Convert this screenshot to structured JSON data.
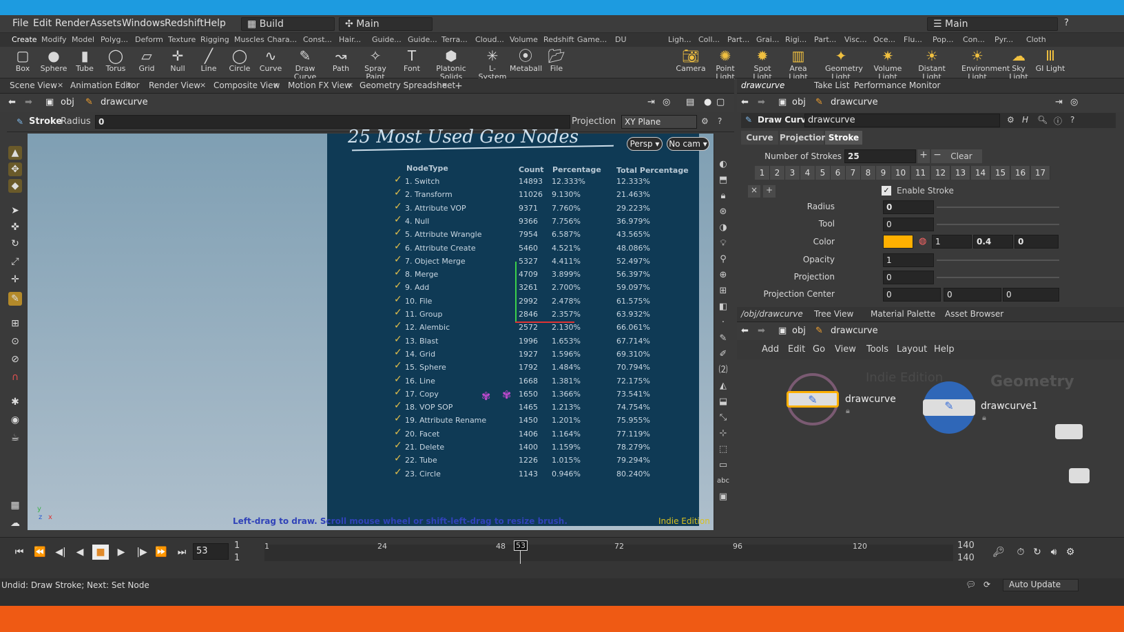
{
  "menu": [
    "File",
    "Edit",
    "Render",
    "Assets",
    "Windows",
    "Redshift",
    "Help"
  ],
  "desktop": {
    "build": "Build",
    "main": "Main",
    "right_main": "Main"
  },
  "shelf_tabs_left": [
    "Create",
    "Modify",
    "Model",
    "Polyg...",
    "Deform",
    "Texture",
    "Rigging",
    "Muscles",
    "Chara...",
    "Const...",
    "Hair...",
    "Guide...",
    "Guide...",
    "Terra...",
    "Cloud...",
    "Volume",
    "Redshift",
    "Game...",
    "DU"
  ],
  "shelf_tabs_right": [
    "Ligh...",
    "Coll...",
    "Part...",
    "Grai...",
    "Rigi...",
    "Part...",
    "Visc...",
    "Oce...",
    "Flu...",
    "Pop...",
    "Con...",
    "Pyr...",
    "Cloth"
  ],
  "tools_left": [
    "Box",
    "Sphere",
    "Tube",
    "Torus",
    "Grid",
    "Null",
    "Line",
    "Circle",
    "Curve",
    "Draw Curve",
    "Path",
    "Spray Paint",
    "Font",
    "Platonic Solids",
    "L-System",
    "Metaball",
    "File"
  ],
  "tools_right": [
    "Camera",
    "Point Light",
    "Spot Light",
    "Area Light",
    "Geometry Light",
    "Volume Light",
    "Distant Light",
    "Environment Light",
    "Sky Light",
    "GI Light"
  ],
  "pane_tabs_left": [
    "Scene View",
    "Animation Editor",
    "Render View",
    "Composite View",
    "Motion FX View",
    "Geometry Spreadsheet"
  ],
  "pane_tabs_right": [
    "drawcurve",
    "Take List",
    "Performance Monitor"
  ],
  "path": {
    "obj": "obj",
    "node": "drawcurve"
  },
  "stroke_bar": {
    "label": "Stroke",
    "radius_label": "Radius",
    "radius_value": "0",
    "projection_label": "Projection",
    "projection_value": "XY Plane"
  },
  "viewport": {
    "persp": "Persp",
    "nocam": "No cam",
    "hint": "Left-drag to draw.  Scroll mouse wheel or shift-left-drag to resize brush.",
    "edition": "Indie Edition",
    "title": "25 Most Used Geo Nodes"
  },
  "table": {
    "headers": [
      "NodeType",
      "Count",
      "Percentage",
      "Total Percentage"
    ],
    "rows": [
      [
        "1. Switch",
        "14893",
        "12.333%",
        "12.333%"
      ],
      [
        "2. Transform",
        "11026",
        "9.130%",
        "21.463%"
      ],
      [
        "3. Attribute VOP",
        "9371",
        "7.760%",
        "29.223%"
      ],
      [
        "4. Null",
        "9366",
        "7.756%",
        "36.979%"
      ],
      [
        "5. Attribute Wrangle",
        "7954",
        "6.587%",
        "43.565%"
      ],
      [
        "6. Attribute Create",
        "5460",
        "4.521%",
        "48.086%"
      ],
      [
        "7. Object Merge",
        "5327",
        "4.411%",
        "52.497%"
      ],
      [
        "8. Merge",
        "4709",
        "3.899%",
        "56.397%"
      ],
      [
        "9. Add",
        "3261",
        "2.700%",
        "59.097%"
      ],
      [
        "10. File",
        "2992",
        "2.478%",
        "61.575%"
      ],
      [
        "11. Group",
        "2846",
        "2.357%",
        "63.932%"
      ],
      [
        "12. Alembic",
        "2572",
        "2.130%",
        "66.061%"
      ],
      [
        "13. Blast",
        "1996",
        "1.653%",
        "67.714%"
      ],
      [
        "14. Grid",
        "1927",
        "1.596%",
        "69.310%"
      ],
      [
        "15. Sphere",
        "1792",
        "1.484%",
        "70.794%"
      ],
      [
        "16. Line",
        "1668",
        "1.381%",
        "72.175%"
      ],
      [
        "17. Copy",
        "1650",
        "1.366%",
        "73.541%"
      ],
      [
        "18. VOP SOP",
        "1465",
        "1.213%",
        "74.754%"
      ],
      [
        "19. Attribute Rename",
        "1450",
        "1.201%",
        "75.955%"
      ],
      [
        "20. Facet",
        "1406",
        "1.164%",
        "77.119%"
      ],
      [
        "21. Delete",
        "1400",
        "1.159%",
        "78.279%"
      ],
      [
        "22. Tube",
        "1226",
        "1.015%",
        "79.294%"
      ],
      [
        "23. Circle",
        "1143",
        "0.946%",
        "80.240%"
      ]
    ]
  },
  "parm": {
    "title": "Draw Curve",
    "node": "drawcurve",
    "tabs": [
      "Curve",
      "Projection",
      "Stroke"
    ],
    "num_strokes_label": "Number of Strokes",
    "num_strokes": "25",
    "clear": "Clear",
    "stroke_tabs": [
      "1",
      "2",
      "3",
      "4",
      "5",
      "6",
      "7",
      "8",
      "9",
      "10",
      "11",
      "12",
      "13",
      "14",
      "15",
      "16",
      "17"
    ],
    "enable": "Enable Stroke",
    "radius_label": "Radius",
    "radius": "0",
    "tool_label": "Tool",
    "tool": "0",
    "color_label": "Color",
    "color_g": "1",
    "color_b": "0.4",
    "color_a": "0",
    "opacity_label": "Opacity",
    "opacity": "1",
    "projection_label": "Projection",
    "projection": "0",
    "pc_label": "Projection Center",
    "pc": [
      "0",
      "0",
      "0"
    ]
  },
  "netview": {
    "tabs": [
      "/obj/drawcurve",
      "Tree View",
      "Material Palette",
      "Asset Browser"
    ],
    "menu": [
      "Add",
      "Edit",
      "Go",
      "View",
      "Tools",
      "Layout",
      "Help"
    ],
    "watermark1": "Indie Edition",
    "watermark2": "Geometry",
    "node1": "drawcurve",
    "node2": "drawcurve1"
  },
  "timeline": {
    "frame": "53",
    "start": "1",
    "start2": "1",
    "end": "140",
    "end2": "140",
    "ticks": [
      "1",
      "24",
      "48",
      "53",
      "72",
      "96",
      "120"
    ]
  },
  "status": {
    "text": "Undid: Draw Stroke; Next: Set Node",
    "auto": "Auto Update"
  },
  "colors": {
    "accent": "#ffb000",
    "board": "#0f3a55",
    "top": "#1d9be0",
    "bottom": "#ef5a14"
  }
}
